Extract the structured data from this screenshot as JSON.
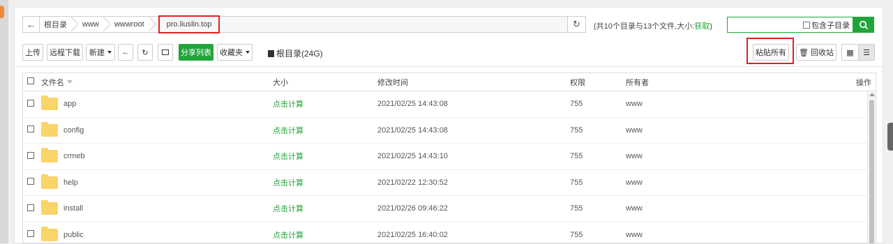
{
  "breadcrumb": {
    "items": [
      "根目录",
      "www",
      "wwwroot"
    ],
    "current": "pro.liuslin.top"
  },
  "summary": {
    "text": "(共10个目录与13个文件,大小:",
    "link": "获取",
    "close": ")"
  },
  "search": {
    "include_sub_label": "包含子目录",
    "icon": "search-icon"
  },
  "toolbar": {
    "upload": "上传",
    "remote_download": "远程下载",
    "new": "新建",
    "share_list": "分享列表",
    "favorites": "收藏夹",
    "disk": "根目录(24G)",
    "paste_all": "粘贴所有",
    "recycle_bin": "回收站"
  },
  "table": {
    "headers": {
      "name": "文件名",
      "size": "大小",
      "mtime": "修改时间",
      "perm": "权限",
      "owner": "所有者",
      "op": "操作"
    },
    "rows": [
      {
        "name": "app",
        "size": "点击计算",
        "mtime": "2021/02/25 14:43:08",
        "perm": "755",
        "owner": "www"
      },
      {
        "name": "config",
        "size": "点击计算",
        "mtime": "2021/02/25 14:43:08",
        "perm": "755",
        "owner": "www"
      },
      {
        "name": "crmeb",
        "size": "点击计算",
        "mtime": "2021/02/25 14:43:10",
        "perm": "755",
        "owner": "www"
      },
      {
        "name": "help",
        "size": "点击计算",
        "mtime": "2021/02/22 12:30:52",
        "perm": "755",
        "owner": "www"
      },
      {
        "name": "install",
        "size": "点击计算",
        "mtime": "2021/02/26 09:46:22",
        "perm": "755",
        "owner": "www"
      },
      {
        "name": "public",
        "size": "点击计算",
        "mtime": "2021/02/25 16:40:02",
        "perm": "755",
        "owner": "www"
      }
    ]
  },
  "colors": {
    "accent": "#20a53a",
    "highlight": "#e02020",
    "folder": "#f9d469"
  }
}
